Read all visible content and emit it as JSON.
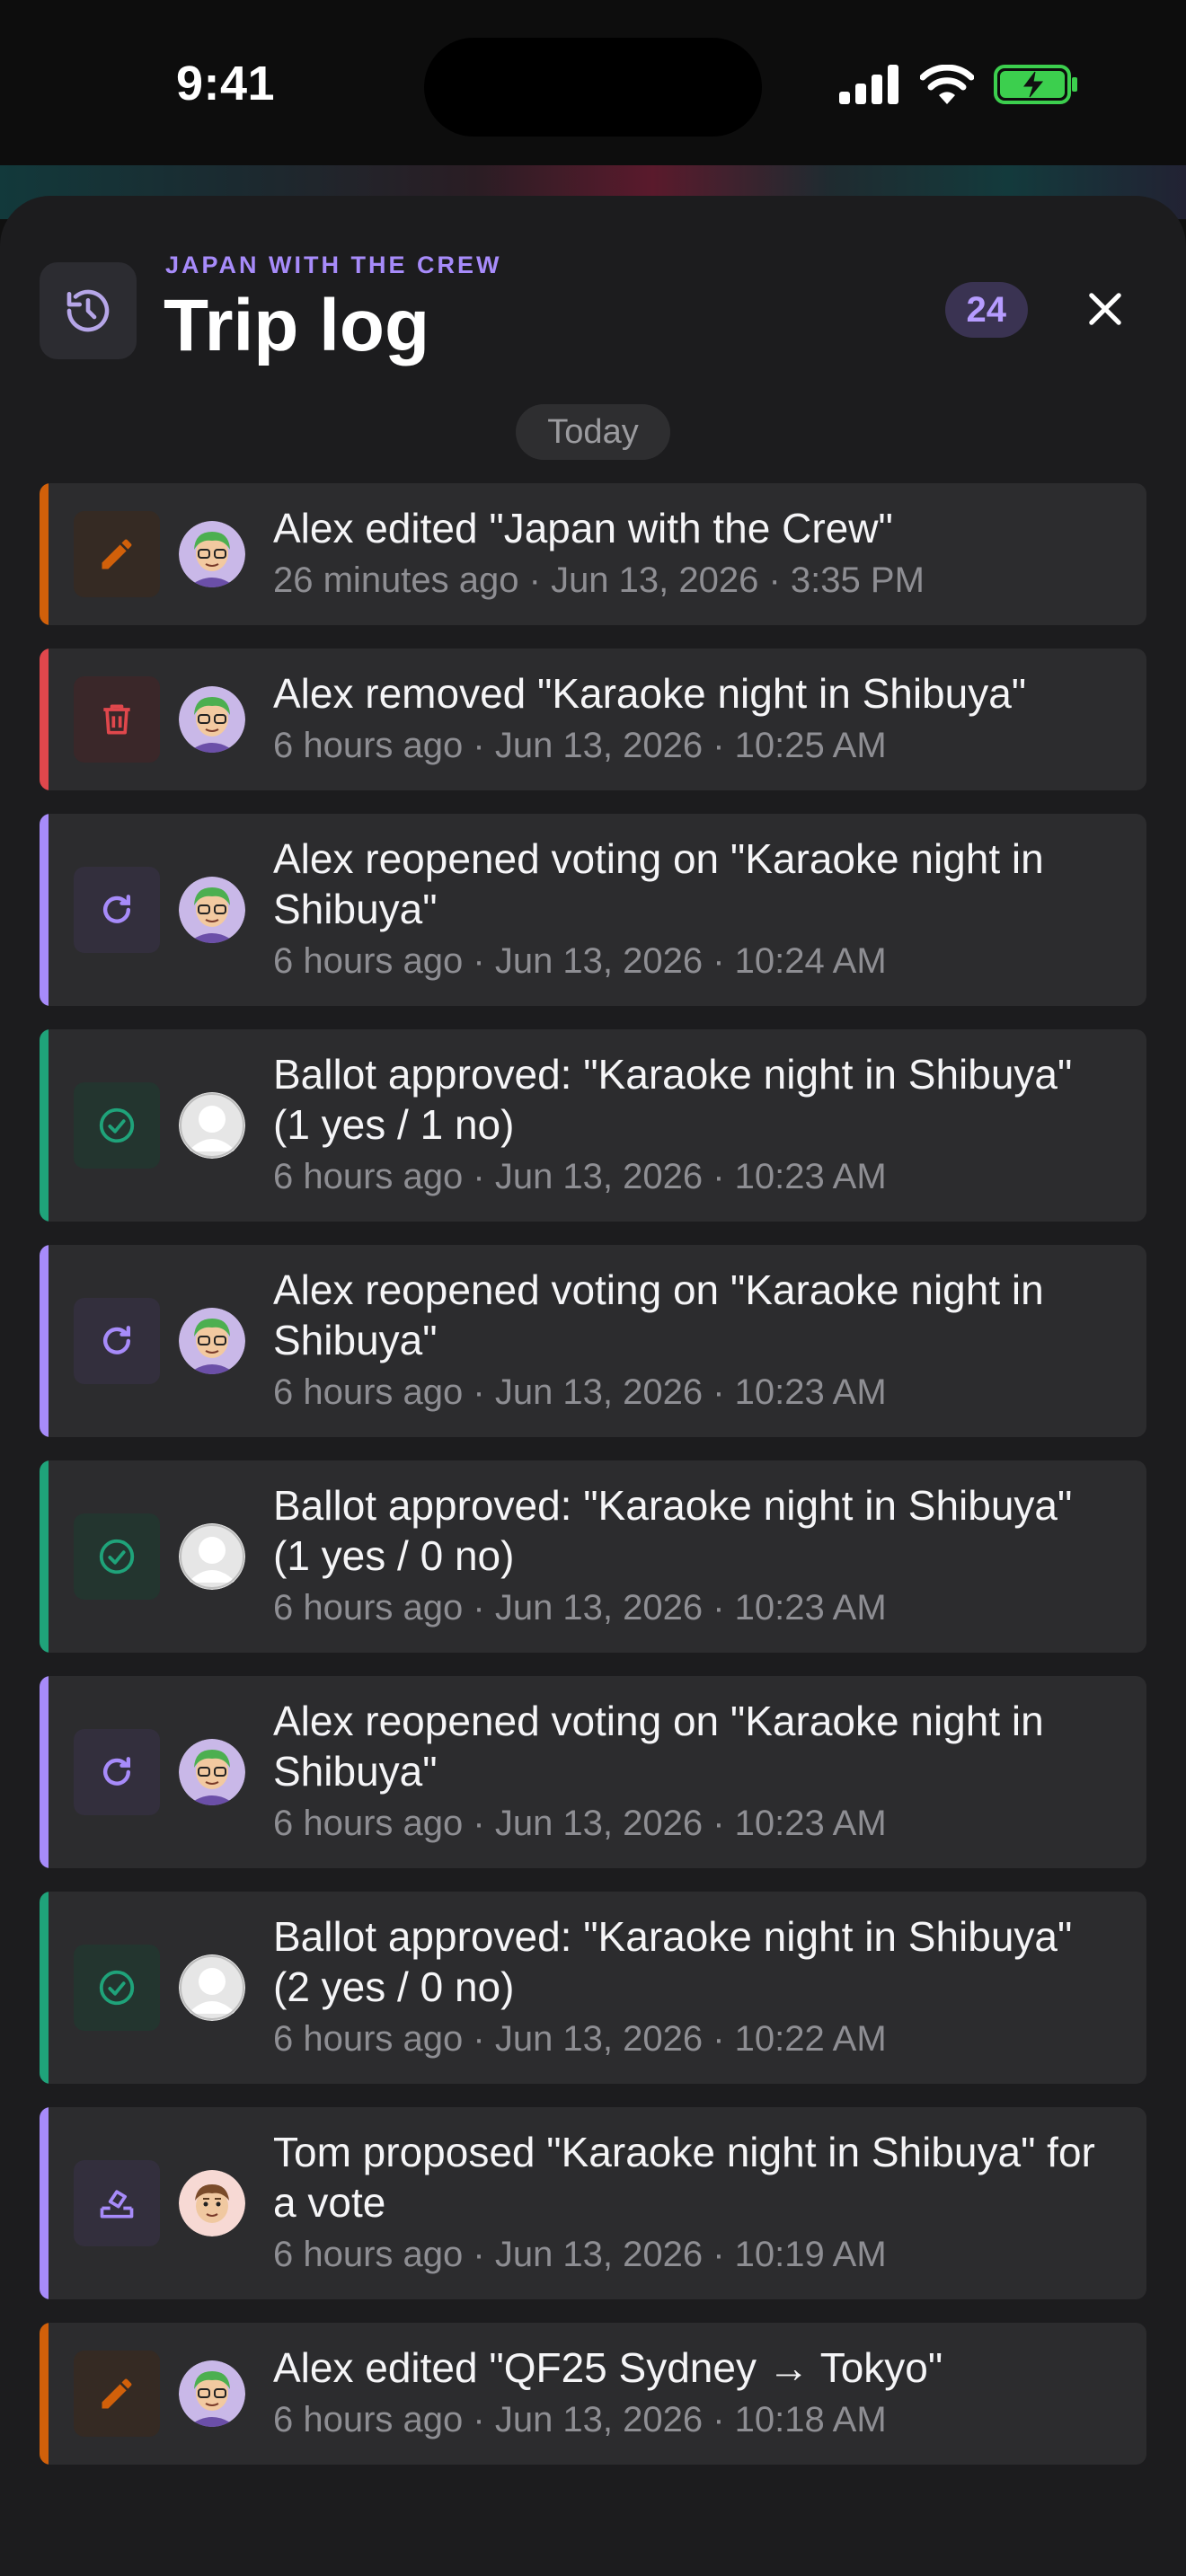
{
  "status_bar": {
    "time": "9:41"
  },
  "header": {
    "eyebrow": "JAPAN WITH THE CREW",
    "title": "Trip log",
    "count": "24",
    "history_icon": "history-icon",
    "close_icon": "close-icon"
  },
  "day_label": "Today",
  "colors": {
    "edit": "#d1600a",
    "delete": "#e0474c",
    "vote": "#a78bfa",
    "approve": "#1fa37a"
  },
  "entries": [
    {
      "type": "edit",
      "icon": "pencil-icon",
      "avatar": "alex-avatar",
      "message": "Alex edited \"Japan with the Crew\"",
      "meta": "26 minutes ago · Jun 13, 2026 · 3:35 PM"
    },
    {
      "type": "delete",
      "icon": "trash-icon",
      "avatar": "alex-avatar",
      "message": "Alex removed \"Karaoke night in Shibuya\"",
      "meta": "6 hours ago · Jun 13, 2026 · 10:25 AM"
    },
    {
      "type": "vote",
      "icon": "reopen-icon",
      "avatar": "alex-avatar",
      "message": "Alex reopened voting on \"Karaoke night in Shibuya\"",
      "meta": "6 hours ago · Jun 13, 2026 · 10:24 AM"
    },
    {
      "type": "approve",
      "icon": "check-circle-icon",
      "avatar": "default-avatar",
      "message": "Ballot approved: \"Karaoke night in Shibuya\" (1 yes / 1 no)",
      "meta": "6 hours ago · Jun 13, 2026 · 10:23 AM"
    },
    {
      "type": "vote",
      "icon": "reopen-icon",
      "avatar": "alex-avatar",
      "message": "Alex reopened voting on \"Karaoke night in Shibuya\"",
      "meta": "6 hours ago · Jun 13, 2026 · 10:23 AM"
    },
    {
      "type": "approve",
      "icon": "check-circle-icon",
      "avatar": "default-avatar",
      "message": "Ballot approved: \"Karaoke night in Shibuya\" (1 yes / 0 no)",
      "meta": "6 hours ago · Jun 13, 2026 · 10:23 AM"
    },
    {
      "type": "vote",
      "icon": "reopen-icon",
      "avatar": "alex-avatar",
      "message": "Alex reopened voting on \"Karaoke night in Shibuya\"",
      "meta": "6 hours ago · Jun 13, 2026 · 10:23 AM"
    },
    {
      "type": "approve",
      "icon": "check-circle-icon",
      "avatar": "default-avatar",
      "message": "Ballot approved: \"Karaoke night in Shibuya\" (2 yes / 0 no)",
      "meta": "6 hours ago · Jun 13, 2026 · 10:22 AM"
    },
    {
      "type": "vote",
      "icon": "ballot-icon",
      "avatar": "tom-avatar",
      "message": "Tom proposed \"Karaoke night in Shibuya\" for a vote",
      "meta": "6 hours ago · Jun 13, 2026 · 10:19 AM"
    },
    {
      "type": "edit",
      "icon": "pencil-icon",
      "avatar": "alex-avatar",
      "message": "Alex edited \"QF25 Sydney → Tokyo\"",
      "meta": "6 hours ago · Jun 13, 2026 · 10:18 AM"
    }
  ]
}
